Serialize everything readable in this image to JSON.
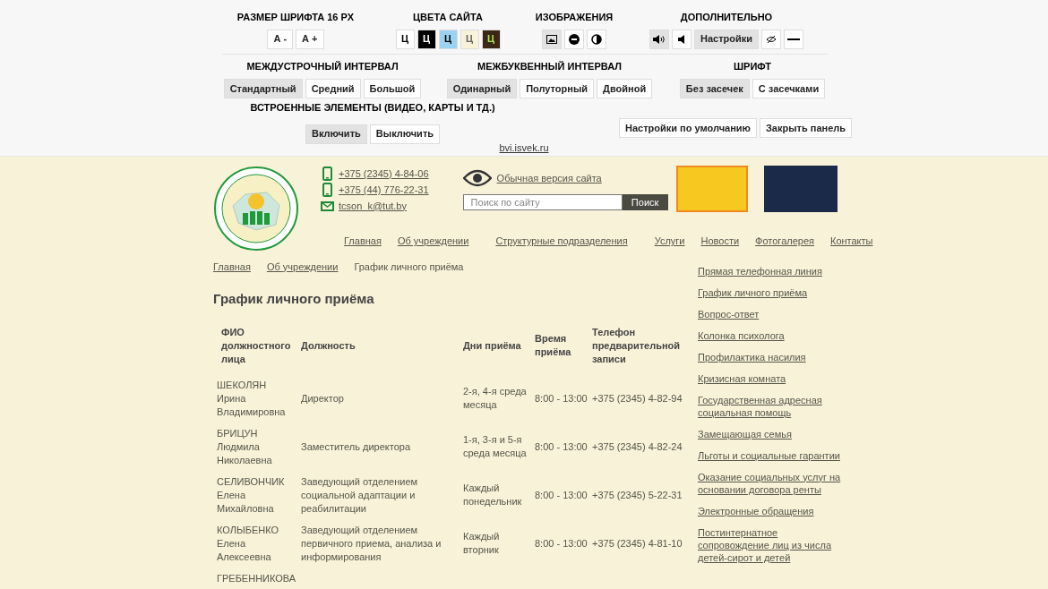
{
  "accessibility_panel": {
    "row_1": [
      {
        "title": "РАЗМЕР ШРИФТА 16 PX",
        "buttons": [
          {
            "kind": "text",
            "label": "А -",
            "selected": false
          },
          {
            "kind": "text",
            "label": "А +",
            "selected": false
          }
        ]
      },
      {
        "title": "ЦВЕТА САЙТА",
        "buttons": [
          {
            "kind": "swatch",
            "label": "Ц",
            "color": "#ffffff",
            "selected": false
          },
          {
            "kind": "swatch",
            "label": "Ц",
            "color": "#000000",
            "selected": false
          },
          {
            "kind": "swatch",
            "label": "Ц",
            "color": "#9dd1f1",
            "selected": false
          },
          {
            "kind": "swatch",
            "label": "Ц",
            "color": "#f8f2d8",
            "selected": false
          },
          {
            "kind": "swatch",
            "label": "Ц",
            "color": "#3b2716",
            "selected": false
          }
        ]
      },
      {
        "title": "ИЗОБРАЖЕНИЯ",
        "buttons": [
          {
            "kind": "icon",
            "selected": true
          },
          {
            "kind": "icon",
            "selected": false
          },
          {
            "kind": "icon",
            "selected": false
          }
        ]
      },
      {
        "title": "ДОПОЛНИТЕЛЬНО",
        "buttons": [
          {
            "kind": "icon",
            "selected": true
          },
          {
            "kind": "icon",
            "selected": false
          },
          {
            "kind": "text",
            "label": "Настройки",
            "selected": true
          },
          {
            "kind": "icon",
            "selected": false
          },
          {
            "kind": "icon",
            "selected": false
          }
        ]
      }
    ],
    "row_2": [
      {
        "title": "МЕЖДУСТРОЧНЫЙ ИНТЕРВАЛ",
        "buttons": [
          {
            "kind": "text",
            "label": "Стандартный",
            "selected": true
          },
          {
            "kind": "text",
            "label": "Средний",
            "selected": false
          },
          {
            "kind": "text",
            "label": "Большой",
            "selected": false
          }
        ]
      },
      {
        "title": "МЕЖБУКВЕННЫЙ ИНТЕРВАЛ",
        "buttons": [
          {
            "kind": "text",
            "label": "Одинарный",
            "selected": true
          },
          {
            "kind": "text",
            "label": "Полуторный",
            "selected": false
          },
          {
            "kind": "text",
            "label": "Двойной",
            "selected": false
          }
        ]
      },
      {
        "title": "ШРИФТ",
        "buttons": [
          {
            "kind": "text",
            "label": "Без засечек",
            "selected": true
          },
          {
            "kind": "text",
            "label": "С засечками",
            "selected": false
          }
        ]
      }
    ],
    "embedded": {
      "title": "ВСТРОЕННЫЕ ЭЛЕМЕНТЫ (ВИДЕО, КАРТЫ И ТД.)",
      "buttons": [
        {
          "kind": "text",
          "label": "Включить",
          "selected": true
        },
        {
          "kind": "text",
          "label": "Выключить",
          "selected": false
        }
      ]
    },
    "actions": [
      "Настройки по умолчанию",
      "Закрыть панель"
    ],
    "link": "bvi.isvek.ru"
  },
  "header": {
    "contacts": [
      {
        "kind": "phone",
        "text": "+375 (2345) 4-84-06"
      },
      {
        "kind": "phone",
        "text": "+375 (44) 776-22-31"
      },
      {
        "kind": "email",
        "text": "tcson_k@tut.by"
      }
    ],
    "normal_version_link": "Обычная версия сайта",
    "search": {
      "placeholder": "Поиск по сайту",
      "button": "Поиск"
    },
    "nav": [
      "Главная",
      "Об учреждении",
      "Структурные подразделения",
      "Услуги",
      "Новости",
      "Фотогалерея",
      "Контакты"
    ]
  },
  "breadcrumbs": [
    "Главная",
    "Об учреждении",
    "График личного приёма"
  ],
  "page_title": "График личного приёма",
  "table": {
    "columns": [
      "ФИО должностного лица",
      "Должность",
      "Дни приёма",
      "Время приёма",
      "Телефон предварительной записи"
    ],
    "rows": [
      {
        "surname": "ШЕКОЛЯН",
        "given": "Ирина Владимировна",
        "position": "Директор",
        "days": "2-я, 4-я среда месяца",
        "time": "8:00 - 13:00",
        "phone": "+375 (2345) 4-82-94"
      },
      {
        "surname": "БРИЦУН",
        "given": "Людмила Николаевна",
        "position": "Заместитель директора",
        "days": "1-я, 3-я и 5-я среда месяца",
        "time": "8:00 - 13:00",
        "phone": "+375 (2345) 4-82-24"
      },
      {
        "surname": "СЕЛИВОНЧИК",
        "given": "Елена Михайловна",
        "position": "Заведующий отделением социальной адаптации и реабилитации",
        "days": "Каждый понедельник",
        "time": "8:00 - 13:00",
        "phone": "+375 (2345) 5-22-31"
      },
      {
        "surname": "КОЛЫБЕНКО",
        "given": "Елена Алексеевна",
        "position": "Заведующий отделением первичного приема, анализа и информирования",
        "days": "Каждый вторник",
        "time": "8:00 - 13:00",
        "phone": "+375 (2345) 4-81-10"
      },
      {
        "surname": "ГРЕБЕННИКОВА"
      }
    ]
  },
  "sidebar": [
    "Прямая телефонная линия",
    "График личного приёма",
    "Вопрос-ответ",
    "Колонка психолога",
    "Профилактика насилия",
    "Кризисная комната",
    "Государственная адресная социальная помощь",
    "Замещающая семья",
    "Льготы и социальные гарантии",
    "Оказание социальных услуг на основании договора ренты",
    "Электронные обращения",
    "Постинтернатное сопровождение лиц из числа детей-сирот и детей"
  ]
}
